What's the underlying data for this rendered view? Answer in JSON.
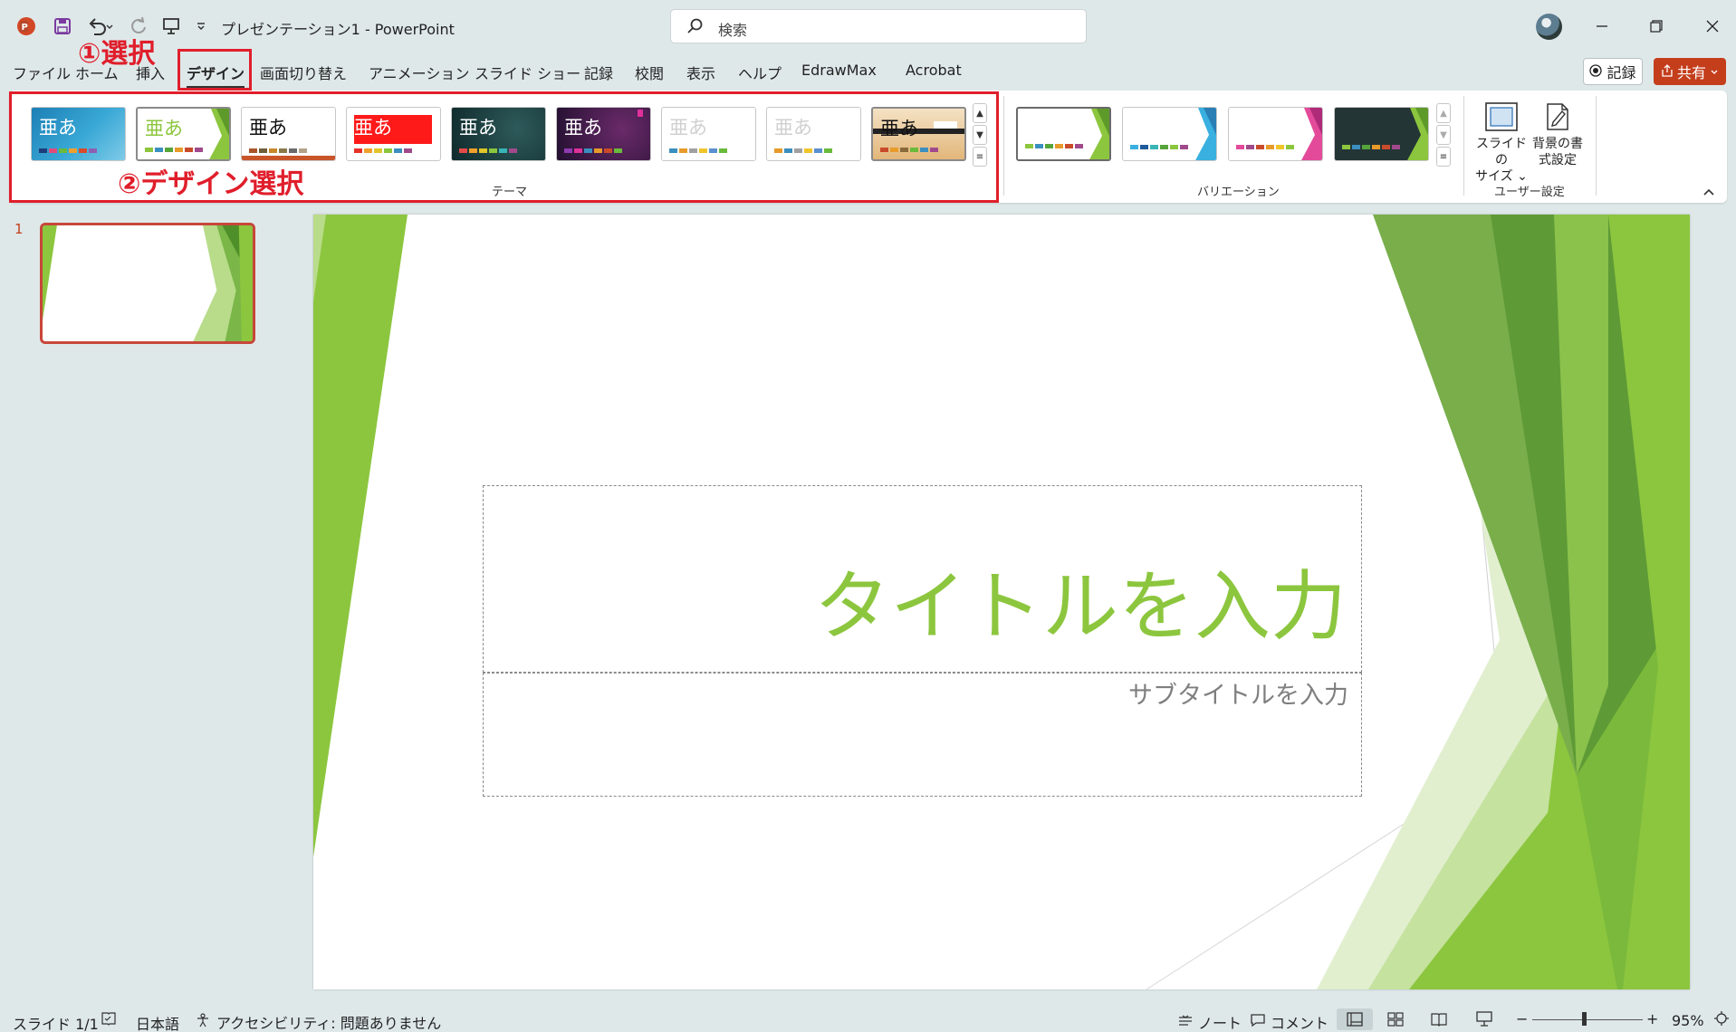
{
  "titlebar": {
    "doc_title": "プレゼンテーション1  -  PowerPoint",
    "search_placeholder": "検索"
  },
  "menu": {
    "tabs": [
      {
        "label": "ファイル"
      },
      {
        "label": "ホーム"
      },
      {
        "label": "挿入"
      },
      {
        "label": "デザイン",
        "active": true
      },
      {
        "label": "画面切り替え"
      },
      {
        "label": "アニメーション"
      },
      {
        "label": "スライド ショー"
      },
      {
        "label": "記録"
      },
      {
        "label": "校閲"
      },
      {
        "label": "表示"
      },
      {
        "label": "ヘルプ"
      },
      {
        "label": "EdrawMax"
      },
      {
        "label": "Acrobat"
      }
    ],
    "record_label": "記録",
    "share_label": "共有"
  },
  "annotations": {
    "step1": "①選択",
    "step2": "②デザイン選択"
  },
  "ribbon": {
    "theme_group_label": "テーマ",
    "variation_group_label": "バリエーション",
    "user_group_label": "ユーザー設定",
    "theme_sample": "亜あ",
    "slide_size_label": "スライドの\nサイズ ⌄",
    "background_format_label": "背景の書\n式設定"
  },
  "thumbnails": {
    "slide_number": "1"
  },
  "slide": {
    "title_placeholder": "タイトルを入力",
    "subtitle_placeholder": "サブタイトルを入力"
  },
  "statusbar": {
    "slide_count": "スライド 1/1",
    "language": "日本語",
    "accessibility": "アクセシビリティ: 問題ありません",
    "notes": "ノート",
    "comments": "コメント",
    "zoom": "95%"
  },
  "colors": {
    "accent_green": "#8cc63e",
    "annotation_red": "#e01e2b",
    "share_orange": "#c43e1c"
  }
}
